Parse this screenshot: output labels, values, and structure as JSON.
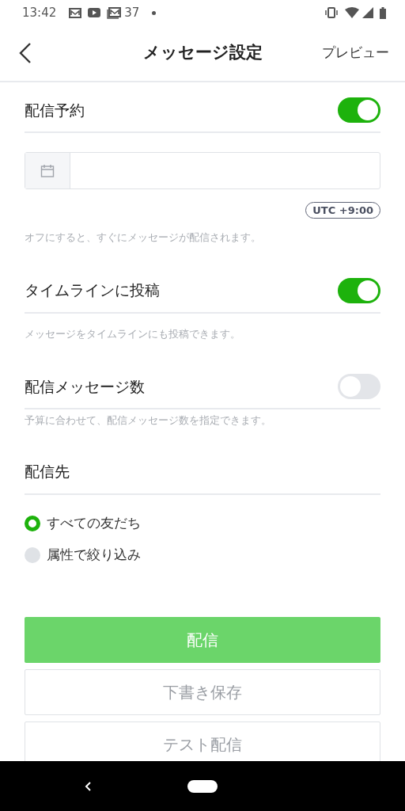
{
  "status_bar": {
    "time": "13:42",
    "notification_count": "37"
  },
  "header": {
    "title": "メッセージ設定",
    "action": "プレビュー"
  },
  "settings": [
    {
      "kind": "schedule",
      "label": "配信予約",
      "on": true,
      "timezone": "UTC +9:00",
      "hint": "オフにすると、すぐにメッセージが配信されます。"
    },
    {
      "kind": "toggle",
      "label": "タイムラインに投稿",
      "on": true,
      "hint": "メッセージをタイムラインにも投稿できます。"
    },
    {
      "kind": "toggle",
      "label": "配信メッセージ数",
      "on": false,
      "hint": "予算に合わせて、配信メッセージ数を指定できます。"
    }
  ],
  "recipients": {
    "label": "配信先",
    "options": [
      {
        "label": "すべての友だち",
        "selected": true
      },
      {
        "label": "属性で絞り込み",
        "selected": false
      }
    ]
  },
  "buttons": [
    {
      "label": "配信",
      "kind": "primary"
    },
    {
      "label": "下書き保存",
      "kind": "outline"
    },
    {
      "label": "テスト配信",
      "kind": "outline"
    }
  ]
}
